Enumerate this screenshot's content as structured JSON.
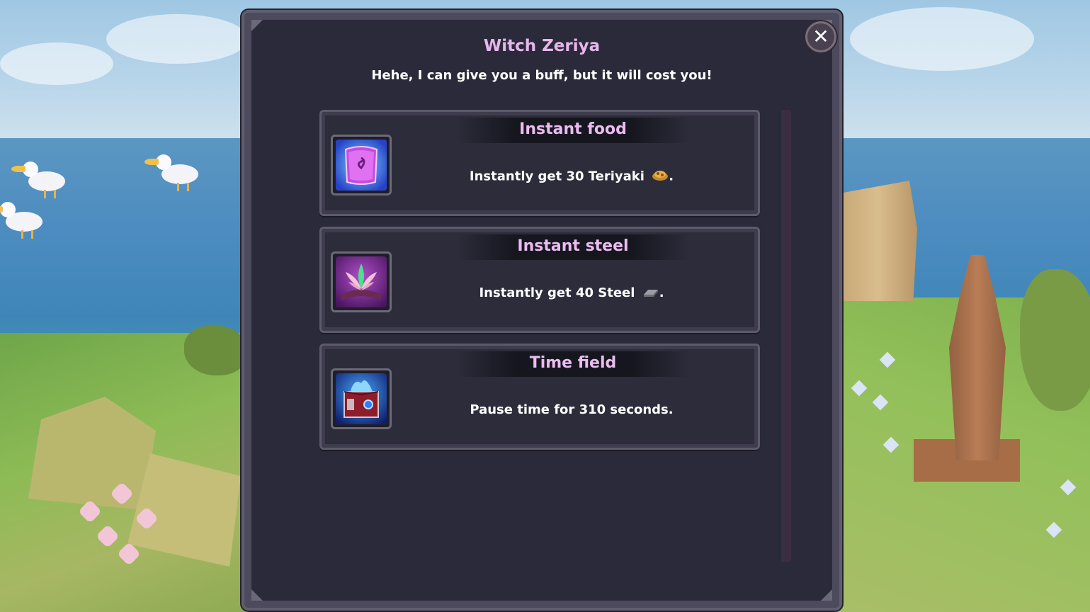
{
  "dialog": {
    "title": "Witch Zeriya",
    "subtitle": "Hehe, I can give you a buff, but it will cost you!",
    "close_icon": "close-icon",
    "close_glyph": "✕"
  },
  "buffs": [
    {
      "title": "Instant food",
      "desc_prefix": "Instantly get 30 Teriyaki",
      "desc_suffix": ".",
      "icon": "magic-scroll-icon",
      "resource_icon": "teriyaki-icon"
    },
    {
      "title": "Instant steel",
      "desc_prefix": "Instantly get 40 Steel",
      "desc_suffix": ".",
      "icon": "lotus-spellbook-icon",
      "resource_icon": "steel-ingot-icon"
    },
    {
      "title": "Time field",
      "desc_prefix": "Pause time for 310 seconds.",
      "desc_suffix": "",
      "icon": "blue-flame-book-icon",
      "resource_icon": ""
    }
  ],
  "colors": {
    "panel": "#2a2a3b",
    "title_pink": "#e6b7ea",
    "border": "#5f5d6e"
  }
}
